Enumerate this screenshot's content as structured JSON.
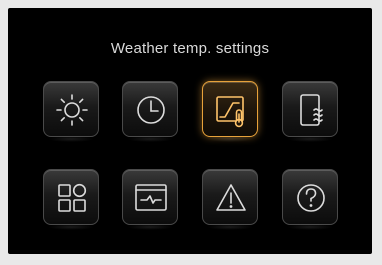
{
  "screen": {
    "title": "Weather temp. settings"
  },
  "tiles": [
    {
      "icon": "sun-icon",
      "active": false
    },
    {
      "icon": "clock-icon",
      "active": false
    },
    {
      "icon": "heating-curve-thermometer-icon",
      "active": true
    },
    {
      "icon": "water-heater-icon",
      "active": false
    },
    {
      "icon": "apps-grid-icon",
      "active": false
    },
    {
      "icon": "system-monitor-window-icon",
      "active": false
    },
    {
      "icon": "warning-icon",
      "active": false
    },
    {
      "icon": "help-icon",
      "active": false
    }
  ],
  "colors": {
    "background": "#000000",
    "tile_border": "#4a4a4a",
    "icon_stroke": "#dcdcdc",
    "active_accent": "#e8a23a"
  }
}
